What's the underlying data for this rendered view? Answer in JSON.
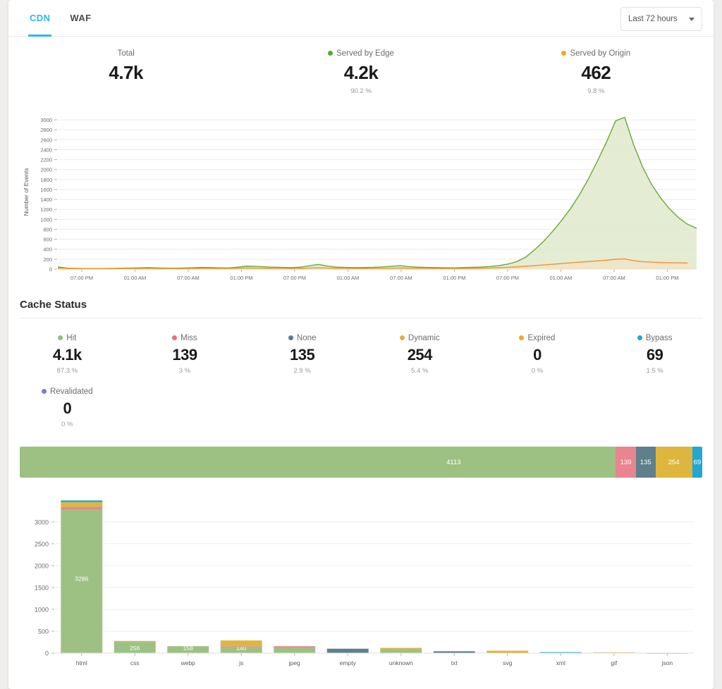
{
  "tabs": [
    {
      "label": "CDN",
      "active": true
    },
    {
      "label": "WAF",
      "active": false
    }
  ],
  "time_range": {
    "label": "Last 72 hours"
  },
  "summary": [
    {
      "label": "Total",
      "value": "4.7k",
      "pct": "",
      "color": ""
    },
    {
      "label": "Served by Edge",
      "value": "4.2k",
      "pct": "90.2 %",
      "color": "#4caf2f"
    },
    {
      "label": "Served by Origin",
      "value": "462",
      "pct": "9.8 %",
      "color": "#f5a623"
    }
  ],
  "cache_status": {
    "title": "Cache Status",
    "items": [
      {
        "label": "Hit",
        "value": "4.1k",
        "pct": "87.3 %",
        "color": "#8cc278"
      },
      {
        "label": "Miss",
        "value": "139",
        "pct": "3 %",
        "color": "#e8707a"
      },
      {
        "label": "None",
        "value": "135",
        "pct": "2.9 %",
        "color": "#5c7b8a"
      },
      {
        "label": "Dynamic",
        "value": "254",
        "pct": "5.4 %",
        "color": "#ddb238"
      },
      {
        "label": "Expired",
        "value": "0",
        "pct": "0 %",
        "color": "#f5a623"
      },
      {
        "label": "Bypass",
        "value": "69",
        "pct": "1.5 %",
        "color": "#22a7d0"
      },
      {
        "label": "Revalidated",
        "value": "0",
        "pct": "0 %",
        "color": "#7b79d8"
      }
    ],
    "stacked_bar": [
      {
        "label": "Hit",
        "value": 4113,
        "show_label": true,
        "color": "#9dc183"
      },
      {
        "label": "Miss",
        "value": 139,
        "show_label": true,
        "color": "#e8858f"
      },
      {
        "label": "None",
        "value": 135,
        "show_label": true,
        "color": "#5e7f8c"
      },
      {
        "label": "Dynamic",
        "value": 254,
        "show_label": true,
        "color": "#dfb63d"
      },
      {
        "label": "Bypass",
        "value": 69,
        "show_label": true,
        "color": "#22a7d0"
      }
    ]
  },
  "chart_data": [
    {
      "type": "area",
      "title": "",
      "xlabel": "",
      "ylabel": "Number of Events",
      "ylim": [
        0,
        3000
      ],
      "yticks": [
        0,
        200,
        400,
        600,
        800,
        1000,
        1200,
        1400,
        1600,
        1800,
        2000,
        2200,
        2400,
        2600,
        2800,
        3000
      ],
      "xticks": [
        "07:00 PM",
        "01:00 AM",
        "07:00 AM",
        "01:00 PM",
        "07:00 PM",
        "01:00 AM",
        "07:00 AM",
        "01:00 PM",
        "07:00 PM",
        "01:00 AM",
        "07:00 AM",
        "01:00 PM"
      ],
      "grid": true,
      "legend": "top",
      "series": [
        {
          "name": "Served by Edge",
          "color": "#6aa832",
          "fill": "#dfeacd",
          "values": [
            45,
            20,
            15,
            12,
            10,
            12,
            14,
            18,
            22,
            26,
            30,
            24,
            20,
            18,
            22,
            28,
            34,
            30,
            26,
            24,
            40,
            60,
            55,
            45,
            38,
            34,
            30,
            40,
            70,
            95,
            60,
            40,
            34,
            30,
            32,
            36,
            44,
            55,
            70,
            50,
            40,
            34,
            30,
            28,
            26,
            30,
            36,
            42,
            52,
            70,
            100,
            150,
            240,
            390,
            560,
            760,
            980,
            1220,
            1500,
            1820,
            2180,
            2560,
            2980,
            3050,
            2500,
            2050,
            1700,
            1430,
            1210,
            1030,
            900,
            820
          ]
        },
        {
          "name": "Served by Origin",
          "color": "#f0932b",
          "fill": "#f2e2c7",
          "values": [
            20,
            14,
            12,
            10,
            9,
            10,
            11,
            12,
            13,
            14,
            15,
            13,
            12,
            11,
            12,
            14,
            16,
            15,
            14,
            13,
            18,
            22,
            20,
            18,
            16,
            15,
            14,
            16,
            22,
            28,
            20,
            16,
            15,
            14,
            14,
            15,
            17,
            19,
            22,
            18,
            16,
            15,
            14,
            13,
            13,
            14,
            16,
            18,
            22,
            28,
            36,
            46,
            58,
            70,
            84,
            98,
            112,
            126,
            140,
            152,
            166,
            180,
            198,
            206,
            170,
            150,
            140,
            134,
            130,
            126,
            122
          ]
        }
      ]
    },
    {
      "type": "bar",
      "stacked": true,
      "title": "",
      "xlabel": "",
      "ylabel": "",
      "ylim": [
        0,
        3500
      ],
      "yticks": [
        0,
        500,
        1000,
        1500,
        2000,
        2500,
        3000
      ],
      "categories": [
        "html",
        "css",
        "webp",
        "js",
        "jpeg",
        "empty",
        "unknown",
        "txt",
        "svg",
        "xml",
        "gif",
        "json"
      ],
      "series": [
        {
          "name": "Hit",
          "color": "#9dc183",
          "values": [
            3286,
            256,
            158,
            140,
            130,
            0,
            95,
            0,
            0,
            0,
            0,
            0
          ],
          "labels": [
            "3286",
            "256",
            "158",
            "140",
            "",
            "",
            "",
            "",
            "",
            "",
            "",
            ""
          ]
        },
        {
          "name": "Miss",
          "color": "#e8858f",
          "values": [
            55,
            0,
            0,
            18,
            28,
            0,
            0,
            0,
            0,
            0,
            0,
            0
          ],
          "labels": [
            "",
            "",
            "",
            "",
            "",
            "",
            "",
            "",
            "",
            "",
            "",
            ""
          ]
        },
        {
          "name": "None",
          "color": "#5e7f8c",
          "values": [
            0,
            0,
            0,
            0,
            0,
            100,
            0,
            42,
            0,
            0,
            0,
            0
          ],
          "labels": [
            "",
            "",
            "",
            "",
            "",
            "",
            "",
            "",
            "",
            "",
            "",
            ""
          ]
        },
        {
          "name": "Dynamic",
          "color": "#dfb63d",
          "values": [
            110,
            22,
            0,
            130,
            0,
            0,
            25,
            0,
            55,
            0,
            0,
            0
          ],
          "labels": [
            "",
            "",
            "",
            "",
            "",
            "",
            "",
            "",
            "",
            "",
            "",
            ""
          ]
        },
        {
          "name": "Bypass",
          "color": "#22a7d0",
          "values": [
            40,
            0,
            0,
            0,
            0,
            0,
            0,
            0,
            0,
            22,
            0,
            0
          ],
          "labels": [
            "",
            "",
            "",
            "",
            "",
            "",
            "",
            "",
            "",
            "",
            "",
            ""
          ]
        },
        {
          "name": "Expired",
          "color": "#efc57f",
          "values": [
            0,
            0,
            0,
            0,
            0,
            0,
            0,
            0,
            0,
            0,
            20,
            4
          ],
          "labels": [
            "",
            "",
            "",
            "",
            "",
            "",
            "",
            "",
            "",
            "",
            "",
            ""
          ]
        }
      ]
    }
  ]
}
